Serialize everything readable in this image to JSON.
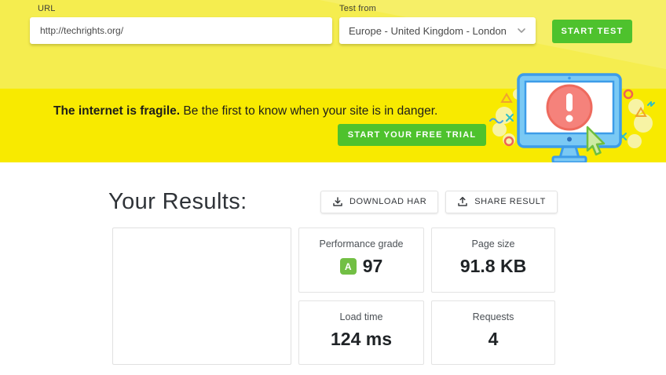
{
  "colors": {
    "header_yellow": "#f5ed4f",
    "banner_yellow": "#f8ea00",
    "button_green": "#4ec22d",
    "badge_green": "#72bf44",
    "monitor_blue": "#3d9ce8",
    "alert_red": "#f5827b"
  },
  "header": {
    "url_label": "URL",
    "url_value": "http://techrights.org/",
    "test_from_label": "Test from",
    "location_value": "Europe - United Kingdom - London",
    "start_test_label": "START TEST"
  },
  "banner": {
    "headline_bold": "The internet is fragile.",
    "headline_rest": "Be the first to know when your site is in danger.",
    "cta_label": "START YOUR FREE TRIAL"
  },
  "results": {
    "heading": "Your Results:",
    "download_har_label": "DOWNLOAD HAR",
    "share_result_label": "SHARE RESULT",
    "performance_grade": {
      "label": "Performance grade",
      "badge": "A",
      "value": "97"
    },
    "page_size": {
      "label": "Page size",
      "value": "91.8 KB"
    },
    "load_time": {
      "label": "Load time",
      "value": "124 ms"
    },
    "requests": {
      "label": "Requests",
      "value": "4"
    }
  }
}
